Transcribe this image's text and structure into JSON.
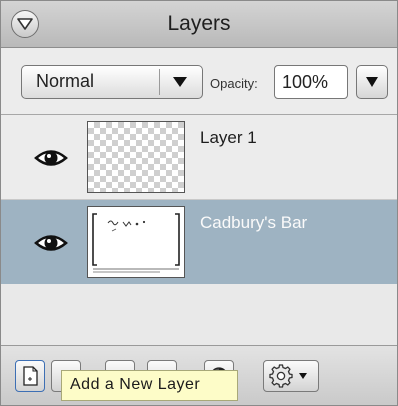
{
  "panel": {
    "title": "Layers"
  },
  "icons": {
    "collapse": "collapse-triangle-icon",
    "visibility": "eye-icon",
    "new_layer": "new-layer-icon",
    "options": "gear-icon",
    "dropdown": "triangle-down-icon"
  },
  "toolbar": {
    "blend_mode": "Normal",
    "opacity_label": "Opacity:",
    "opacity_value": "100%"
  },
  "layers": [
    {
      "name": "Layer 1",
      "selected": false,
      "visible": true
    },
    {
      "name": "Cadbury's Bar",
      "selected": true,
      "visible": true
    }
  ],
  "tooltip": "Add a New Layer",
  "colors": {
    "selected_row": "#9eb3c2",
    "tooltip_bg": "#fdfcc8",
    "panel_bg": "#e6e6e6"
  }
}
